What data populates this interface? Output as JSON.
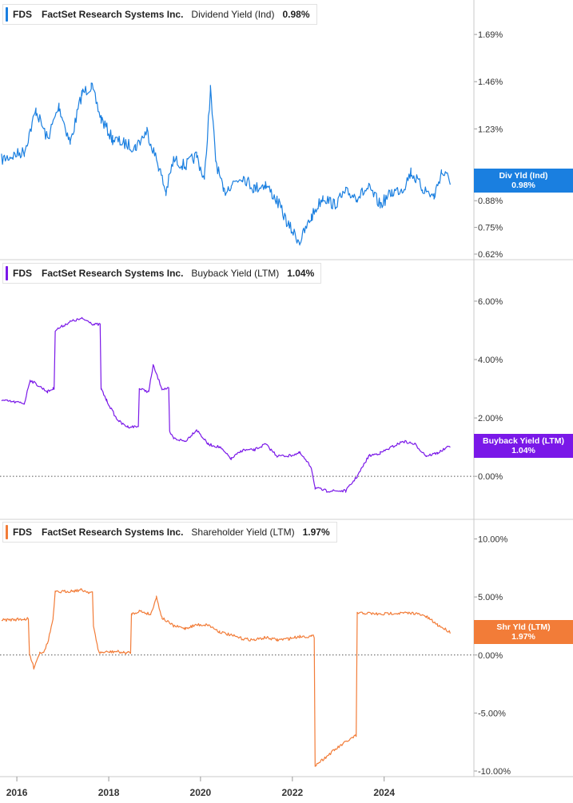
{
  "chart_data": [
    {
      "type": "line",
      "ticker": "FDS",
      "company": "FactSet Research Systems Inc.",
      "metric": "Dividend Yield (Ind)",
      "value": "0.98%",
      "tag_line1": "Div Yld (Ind)",
      "tag_line2": "0.98%",
      "color": "#1a7fe0",
      "ylim": [
        0.62,
        1.78
      ],
      "yticks": [
        0.62,
        0.75,
        0.88,
        1.23,
        1.46,
        1.69
      ],
      "ytick_labels": [
        "0.62%",
        "0.75%",
        "0.88%",
        "1.23%",
        "1.46%",
        "1.69%"
      ],
      "zero_line": false,
      "x": [
        "2015-09-01",
        "2016-03-01",
        "2016-06-01",
        "2016-09-01",
        "2016-12-01",
        "2017-03-01",
        "2017-06-01",
        "2017-08-15",
        "2017-11-01",
        "2018-02-01",
        "2018-05-01",
        "2018-08-01",
        "2018-11-01",
        "2019-02-01",
        "2019-04-01",
        "2019-06-01",
        "2019-09-01",
        "2019-12-01",
        "2020-02-01",
        "2020-03-20",
        "2020-05-01",
        "2020-07-01",
        "2020-09-01",
        "2020-12-01",
        "2021-03-01",
        "2021-06-01",
        "2021-09-01",
        "2021-12-01",
        "2022-03-01",
        "2022-06-01",
        "2022-09-01",
        "2022-12-01",
        "2023-03-01",
        "2023-06-01",
        "2023-09-01",
        "2023-12-01",
        "2024-03-01",
        "2024-06-01",
        "2024-08-01",
        "2024-11-01",
        "2025-02-01",
        "2025-04-01",
        "2025-06-10"
      ],
      "values": [
        1.08,
        1.12,
        1.32,
        1.18,
        1.34,
        1.16,
        1.4,
        1.44,
        1.28,
        1.18,
        1.16,
        1.14,
        1.22,
        1.05,
        0.92,
        1.08,
        1.05,
        1.1,
        0.98,
        1.42,
        1.08,
        0.92,
        0.96,
        1.0,
        0.94,
        0.96,
        0.88,
        0.76,
        0.68,
        0.8,
        0.9,
        0.86,
        0.92,
        0.9,
        0.94,
        0.86,
        0.92,
        0.94,
        1.02,
        0.94,
        0.9,
        1.02,
        0.98
      ]
    },
    {
      "type": "line",
      "ticker": "FDS",
      "company": "FactSet Research Systems Inc.",
      "metric": "Buyback Yield (LTM)",
      "value": "1.04%",
      "tag_line1": "Buyback Yield (LTM)",
      "tag_line2": "1.04%",
      "color": "#7a18e8",
      "ylim": [
        -1.2,
        6.6
      ],
      "yticks": [
        0,
        2,
        4,
        6
      ],
      "ytick_labels": [
        "0.00%",
        "2.00%",
        "4.00%",
        "6.00%"
      ],
      "zero_line": true,
      "x": [
        "2015-09-01",
        "2016-03-01",
        "2016-04-15",
        "2016-09-01",
        "2016-10-15",
        "2016-11-01",
        "2017-03-01",
        "2017-06-01",
        "2017-08-01",
        "2017-09-01",
        "2017-11-01",
        "2017-12-15",
        "2018-03-01",
        "2018-04-15",
        "2018-06-01",
        "2018-09-01",
        "2018-11-15",
        "2018-12-20",
        "2019-03-01",
        "2019-05-01",
        "2019-06-01",
        "2019-09-01",
        "2019-12-01",
        "2020-03-01",
        "2020-06-01",
        "2020-09-01",
        "2020-12-01",
        "2021-03-01",
        "2021-06-01",
        "2021-09-01",
        "2021-12-01",
        "2022-03-01",
        "2022-06-01",
        "2022-07-01",
        "2022-10-01",
        "2023-03-01",
        "2023-06-01",
        "2023-09-01",
        "2023-12-01",
        "2024-03-01",
        "2024-06-01",
        "2024-09-01",
        "2024-12-01",
        "2025-03-01",
        "2025-06-10"
      ],
      "values": [
        2.6,
        2.5,
        3.3,
        2.9,
        3.0,
        5.0,
        5.3,
        5.4,
        5.3,
        5.2,
        3.0,
        2.6,
        2.0,
        1.8,
        1.7,
        3.0,
        2.9,
        3.8,
        3.0,
        1.5,
        1.3,
        1.2,
        1.6,
        1.1,
        1.0,
        0.6,
        0.9,
        0.9,
        1.1,
        0.7,
        0.7,
        0.8,
        0.3,
        -0.4,
        -0.5,
        -0.5,
        0.0,
        0.7,
        0.8,
        1.0,
        1.2,
        1.1,
        0.7,
        0.8,
        1.04
      ]
    },
    {
      "type": "line",
      "ticker": "FDS",
      "company": "FactSet Research Systems Inc.",
      "metric": "Shareholder Yield (LTM)",
      "value": "1.97%",
      "tag_line1": "Shr Yld (LTM)",
      "tag_line2": "1.97%",
      "color": "#f27c38",
      "ylim": [
        -10.0,
        11.0
      ],
      "yticks": [
        -10,
        -5,
        0,
        5,
        10
      ],
      "ytick_labels": [
        "-10.00%",
        "-5.00%",
        "0.00%",
        "5.00%",
        "10.00%"
      ],
      "zero_line": true,
      "x": [
        "2015-09-01",
        "2016-03-01",
        "2016-04-10",
        "2016-05-15",
        "2016-07-01",
        "2016-08-01",
        "2016-09-01",
        "2016-10-15",
        "2016-11-01",
        "2017-06-01",
        "2017-08-01",
        "2017-09-01",
        "2017-10-15",
        "2018-03-01",
        "2018-05-01",
        "2018-06-01",
        "2018-07-01",
        "2018-09-01",
        "2018-12-01",
        "2019-01-15",
        "2019-03-01",
        "2019-06-01",
        "2019-09-01",
        "2019-12-01",
        "2020-03-01",
        "2020-06-01",
        "2020-09-01",
        "2020-12-01",
        "2021-03-01",
        "2021-06-01",
        "2021-09-01",
        "2021-12-01",
        "2022-03-01",
        "2022-06-01",
        "2022-07-01",
        "2022-09-01",
        "2022-12-01",
        "2023-03-01",
        "2023-05-15",
        "2023-06-01",
        "2023-09-01",
        "2023-12-01",
        "2024-03-01",
        "2024-06-01",
        "2024-09-01",
        "2024-12-01",
        "2025-03-01",
        "2025-06-10"
      ],
      "values": [
        3.0,
        3.1,
        0.1,
        -1.1,
        0.2,
        0.3,
        1.0,
        3.1,
        5.4,
        5.6,
        5.4,
        2.5,
        0.2,
        0.3,
        0.2,
        0.2,
        3.5,
        3.8,
        3.5,
        5.0,
        3.2,
        2.5,
        2.3,
        2.6,
        2.6,
        2.0,
        1.7,
        1.4,
        1.3,
        1.5,
        1.3,
        1.4,
        1.6,
        1.6,
        -9.5,
        -9.0,
        -8.2,
        -7.5,
        -7.0,
        3.6,
        3.6,
        3.5,
        3.6,
        3.6,
        3.6,
        3.3,
        2.6,
        1.97
      ]
    }
  ],
  "x_axis": {
    "ticks": [
      "2016-01-01",
      "2018-01-01",
      "2020-01-01",
      "2022-01-01",
      "2024-01-01"
    ],
    "labels": [
      "2016",
      "2018",
      "2020",
      "2022",
      "2024"
    ]
  }
}
